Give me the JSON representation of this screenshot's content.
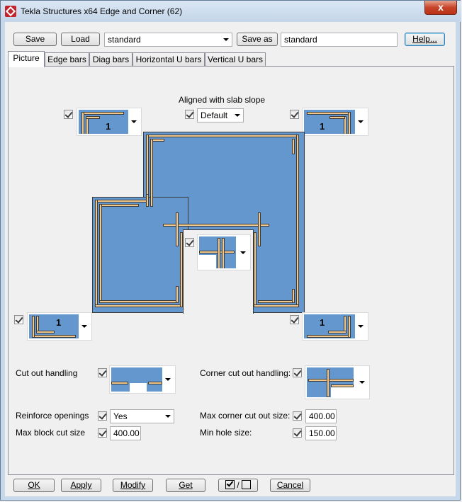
{
  "window": {
    "title": "Tekla Structures x64  Edge and Corner (62)",
    "close_glyph": "x"
  },
  "toolbar": {
    "save_label": "Save",
    "load_label": "Load",
    "preset_value": "standard",
    "save_as_label": "Save as",
    "save_as_value": "standard",
    "help_label": "Help..."
  },
  "tabs": [
    "Picture",
    "Edge bars",
    "Diag bars",
    "Horizontal U bars",
    "Vertical U bars"
  ],
  "picture": {
    "aligned_label": "Aligned with slab slope",
    "aligned_value": "Default",
    "pic_number": "1"
  },
  "options": {
    "cut_out_label": "Cut out handling",
    "corner_cut_out_label": "Corner cut out handling:",
    "reinforce_label": "Reinforce openings",
    "reinforce_value": "Yes",
    "max_corner_label": "Max corner cut out size:",
    "max_corner_value": "400.00",
    "max_block_label": "Max block cut size",
    "max_block_value": "400.00",
    "min_hole_label": "Min hole size:",
    "min_hole_value": "150.00"
  },
  "footer": {
    "ok_label": "OK",
    "apply_label": "Apply",
    "modify_label": "Modify",
    "get_label": "Get",
    "toggle_label": "/",
    "cancel_label": "Cancel"
  },
  "colors": {
    "slab": "#6597cf",
    "bar": "#f3c98b"
  }
}
